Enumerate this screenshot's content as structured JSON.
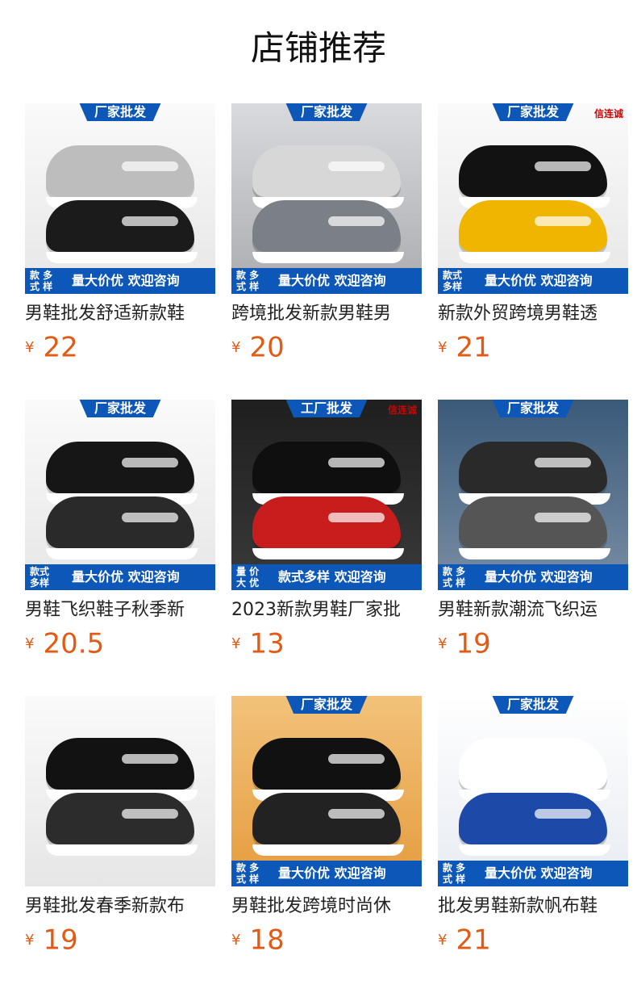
{
  "header": {
    "title": "店铺推荐"
  },
  "colors": {
    "banner_blue": "#0c57b8",
    "price_orange": "#e15b16",
    "corner_red": "#d10000"
  },
  "products": [
    {
      "top_banner": "厂家批发",
      "corner_tag": "",
      "bottom_left": "款 多\n式 样",
      "bottom_right": "量大价优 欢迎咨询",
      "title": "男鞋批发舒适新款鞋",
      "currency": "¥",
      "price": "22",
      "image": {
        "icon": "shoe-product-image",
        "bg": "bg-light",
        "shoe1": "#bdbdbd",
        "shoe2": "#1b1b1b"
      }
    },
    {
      "top_banner": "厂家批发",
      "corner_tag": "",
      "bottom_left": "款 多\n式 样",
      "bottom_right": "量大价优 欢迎咨询",
      "title": "跨境批发新款男鞋男",
      "currency": "¥",
      "price": "20",
      "image": {
        "icon": "shoe-product-image",
        "bg": "bg-gray",
        "shoe1": "#d7d7d7",
        "shoe2": "#7b7f86"
      }
    },
    {
      "top_banner": "厂家批发",
      "corner_tag": "信连诚",
      "bottom_left": "款式\n多样",
      "bottom_right": "量大价优 欢迎咨询",
      "title": "新款外贸跨境男鞋透",
      "currency": "¥",
      "price": "21",
      "image": {
        "icon": "shoe-product-image",
        "bg": "bg-light",
        "shoe1": "#121212",
        "shoe2": "#f0b500"
      }
    },
    {
      "top_banner": "厂家批发",
      "corner_tag": "",
      "bottom_left": "款式\n多样",
      "bottom_right": "量大价优 欢迎咨询",
      "title": "男鞋飞织鞋子秋季新",
      "currency": "¥",
      "price": "20.5",
      "image": {
        "icon": "shoe-product-image",
        "bg": "bg-light",
        "shoe1": "#161616",
        "shoe2": "#2a2a2a"
      }
    },
    {
      "top_banner": "工厂批发",
      "corner_tag": "信连诚",
      "bottom_left": "量 价\n大 优",
      "bottom_right": "款式多样 欢迎咨询",
      "title": "2023新款男鞋厂家批",
      "currency": "¥",
      "price": "13",
      "image": {
        "icon": "shoe-product-image",
        "bg": "bg-dark",
        "shoe1": "#0f0f0f",
        "shoe2": "#c81d1d"
      }
    },
    {
      "top_banner": "厂家批发",
      "corner_tag": "",
      "bottom_left": "款 多\n式 样",
      "bottom_right": "量大价优 欢迎咨询",
      "title": "男鞋新款潮流飞织运",
      "currency": "¥",
      "price": "19",
      "image": {
        "icon": "shoe-product-image",
        "bg": "bg-blue",
        "shoe1": "#2a2a2a",
        "shoe2": "#555"
      }
    },
    {
      "top_banner": "",
      "corner_tag": "",
      "bottom_left": "",
      "bottom_right": "",
      "title": "男鞋批发春季新款布",
      "currency": "¥",
      "price": "19",
      "image": {
        "icon": "shoe-product-image",
        "bg": "bg-light",
        "shoe1": "#121212",
        "shoe2": "#2c2c2c"
      }
    },
    {
      "top_banner": "厂家批发",
      "corner_tag": "",
      "bottom_left": "款 多\n式 样",
      "bottom_right": "量大价优 欢迎咨询",
      "title": "男鞋批发跨境时尚休",
      "currency": "¥",
      "price": "18",
      "image": {
        "icon": "shoe-product-image",
        "bg": "bg-orange",
        "shoe1": "#111",
        "shoe2": "#222"
      }
    },
    {
      "top_banner": "厂家批发",
      "corner_tag": "",
      "bottom_left": "款 多\n式 样",
      "bottom_right": "量大价优 欢迎咨询",
      "title": "批发男鞋新款帆布鞋",
      "currency": "¥",
      "price": "21",
      "image": {
        "icon": "shoe-product-image",
        "bg": "bg-white",
        "shoe1": "#ffffff",
        "shoe2": "#1d4aa8"
      }
    }
  ]
}
